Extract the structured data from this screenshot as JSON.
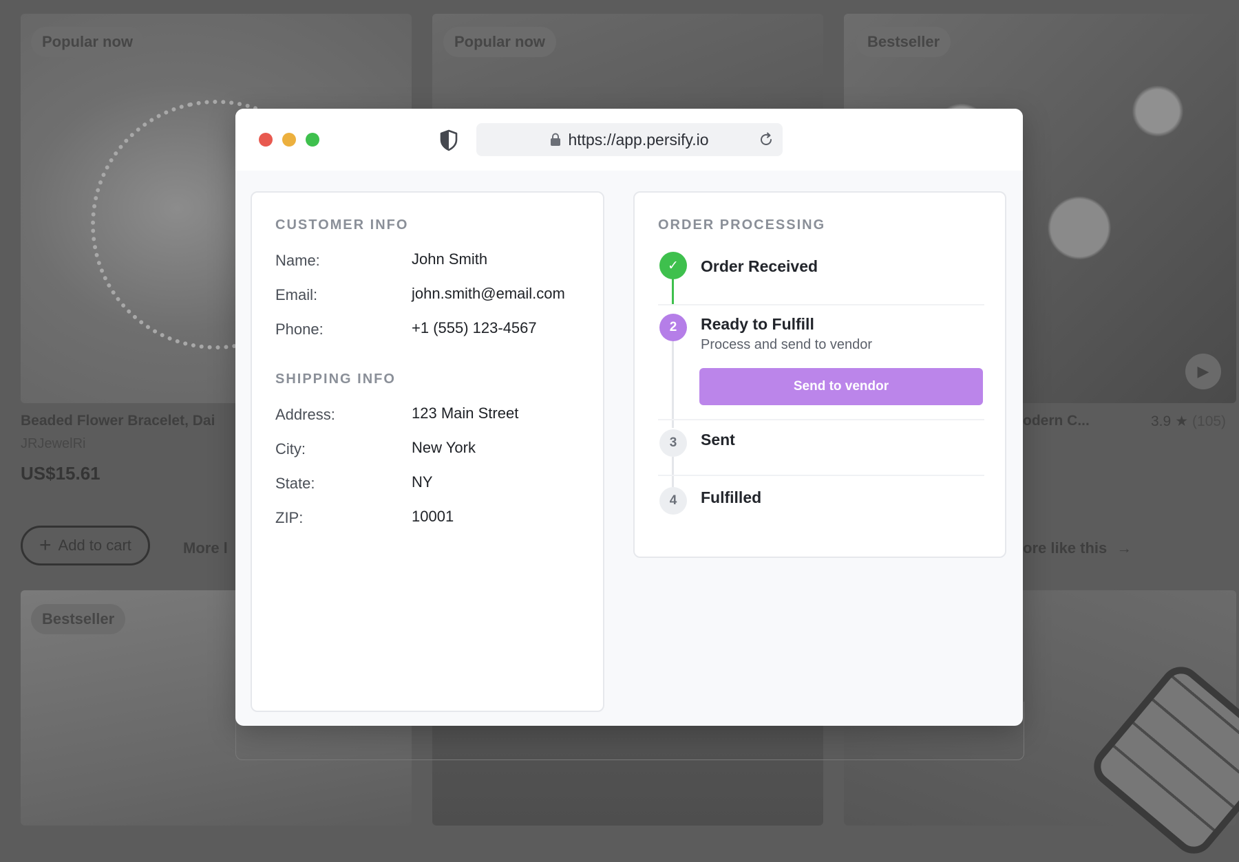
{
  "background": {
    "badges": [
      "Popular now",
      "Popular now",
      "Bestseller",
      "Bestseller"
    ],
    "product": {
      "title": "Beaded Flower Bracelet, Dai",
      "seller": "JRJewelRi",
      "price": "US$15.61"
    },
    "add_to_cart_label": "Add to cart",
    "more_link_left": "More l",
    "more_link_right": "ore like this",
    "product_right_title": "odern C...",
    "rating": "3.9",
    "rating_count": "(105)"
  },
  "browser": {
    "url": "https://app.persify.io"
  },
  "customer_info": {
    "heading": "CUSTOMER INFO",
    "fields": [
      {
        "label": "Name:",
        "value": "John Smith"
      },
      {
        "label": "Email:",
        "value": "john.smith@email.com"
      },
      {
        "label": "Phone:",
        "value": "+1 (555) 123-4567"
      }
    ]
  },
  "shipping_info": {
    "heading": "SHIPPING INFO",
    "fields": [
      {
        "label": "Address:",
        "value": "123 Main Street"
      },
      {
        "label": "City:",
        "value": "New York"
      },
      {
        "label": "State:",
        "value": "NY"
      },
      {
        "label": "ZIP:",
        "value": "10001"
      }
    ]
  },
  "order_processing": {
    "heading": "ORDER PROCESSING",
    "steps": [
      {
        "number": "✓",
        "title": "Order Received",
        "status": "complete"
      },
      {
        "number": "2",
        "title": "Ready to Fulfill",
        "subtitle": "Process and send to vendor",
        "status": "active"
      },
      {
        "number": "3",
        "title": "Sent",
        "status": "pending"
      },
      {
        "number": "4",
        "title": "Fulfilled",
        "status": "pending"
      }
    ],
    "action_button": "Send to vendor"
  },
  "colors": {
    "complete": "#3ec04d",
    "active": "#b57ee8",
    "button": "#bb85ea",
    "pending": "#eceef1"
  }
}
